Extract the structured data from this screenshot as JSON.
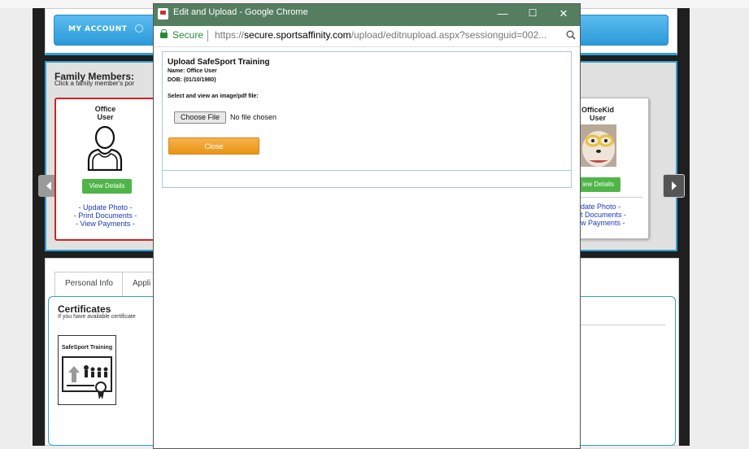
{
  "background_page": {
    "account_button": "MY ACCOUNT",
    "family": {
      "title": "Family Members:",
      "subtitle": "Click a family member's por",
      "members": [
        {
          "name_line1": "Office",
          "name_line2": "User",
          "view_details": "View Details",
          "links": [
            "- Update Photo -",
            "- Print Documents -",
            "- View Payments -"
          ]
        },
        {
          "name_line1": "OfficeKid",
          "name_line2": "User",
          "view_details": "iew Details",
          "links": [
            "date Photo -",
            "t Documents -",
            "w Payments -"
          ]
        }
      ]
    },
    "tabs": [
      "Personal Info",
      "Appli"
    ],
    "certificates": {
      "title": "Certificates",
      "subtitle": "If you have available certificate",
      "card_label": "SafeSport Training"
    }
  },
  "popup": {
    "window_title": "Edit and Upload - Google Chrome",
    "controls": {
      "minimize": "—",
      "maximize": "☐",
      "close": "✕"
    },
    "address": {
      "secure_label": "Secure",
      "scheme": "https://",
      "host": "secure.sportsaffinity.com",
      "path": "/upload/editnupload.aspx?sessionguid=002..."
    },
    "form": {
      "title": "Upload SafeSport Training",
      "name_line": "Name: Office User",
      "dob_line": "DOB: (01/10/1980)",
      "prompt": "Select and view an image/pdf file:",
      "choose_button": "Choose File",
      "no_file": "No file chosen",
      "close_button": "Close"
    }
  },
  "colors": {
    "titlebar": "#557e61",
    "accent_blue": "#2e9fd1",
    "close_orange": "#ea9415",
    "view_green": "#4fb548",
    "selected_red": "#d32020"
  }
}
